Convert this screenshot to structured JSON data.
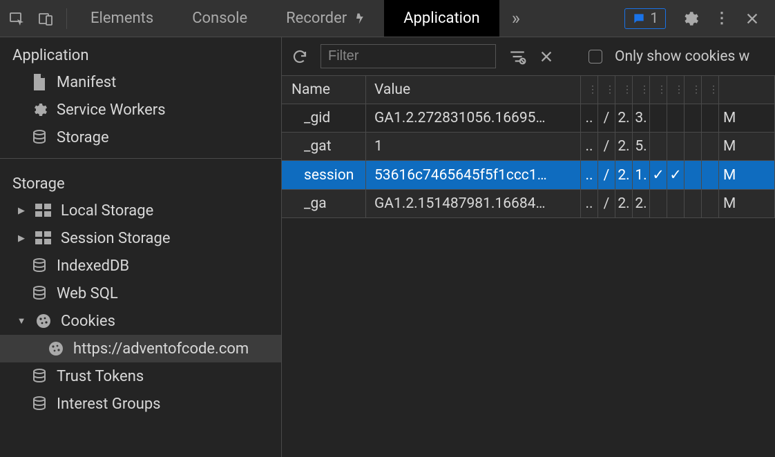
{
  "tabs": {
    "items": [
      "Elements",
      "Console",
      "Recorder",
      "Application"
    ],
    "active": "Application",
    "more_icon": "chevrons",
    "issues_count": "1"
  },
  "sidebar": {
    "groups": [
      {
        "title": "Application",
        "items": [
          {
            "icon": "file",
            "label": "Manifest"
          },
          {
            "icon": "gear",
            "label": "Service Workers"
          },
          {
            "icon": "db",
            "label": "Storage"
          }
        ]
      },
      {
        "title": "Storage",
        "items": [
          {
            "arrow": "right",
            "icon": "table",
            "label": "Local Storage"
          },
          {
            "arrow": "right",
            "icon": "table",
            "label": "Session Storage"
          },
          {
            "icon": "db",
            "label": "IndexedDB"
          },
          {
            "icon": "db",
            "label": "Web SQL"
          },
          {
            "arrow": "down",
            "icon": "cookie",
            "label": "Cookies",
            "expanded": true,
            "children": [
              {
                "icon": "cookie",
                "label": "https://adventofcode.com",
                "selected": true
              }
            ]
          },
          {
            "icon": "db",
            "label": "Trust Tokens"
          },
          {
            "icon": "db",
            "label": "Interest Groups"
          }
        ]
      }
    ]
  },
  "toolbar": {
    "filter_placeholder": "Filter",
    "only_cookies_label": "Only show cookies w"
  },
  "table": {
    "headers": [
      "Name",
      "Value"
    ],
    "rows": [
      {
        "name": "_gid",
        "value": "GA1.2.272831056.16695…",
        "c1": "..",
        "c2": "/",
        "c3": "2.",
        "c4": "3.",
        "c5": "",
        "c6": "",
        "c7": "",
        "c8": "",
        "last": "M"
      },
      {
        "name": "_gat",
        "value": "1",
        "c1": "..",
        "c2": "/",
        "c3": "2.",
        "c4": "5.",
        "c5": "",
        "c6": "",
        "c7": "",
        "c8": "",
        "last": "M",
        "alt": true
      },
      {
        "name": "session",
        "value": "53616c7465645f5f1ccc1…",
        "c1": "..",
        "c2": "/",
        "c3": "2.",
        "c4": "1.",
        "c5": "✓",
        "c6": "✓",
        "c7": "",
        "c8": "",
        "last": "M",
        "selected": true
      },
      {
        "name": "_ga",
        "value": "GA1.2.151487981.16684…",
        "c1": "..",
        "c2": "/",
        "c3": "2.",
        "c4": "2.",
        "c5": "",
        "c6": "",
        "c7": "",
        "c8": "",
        "last": "M",
        "alt": true
      }
    ]
  }
}
